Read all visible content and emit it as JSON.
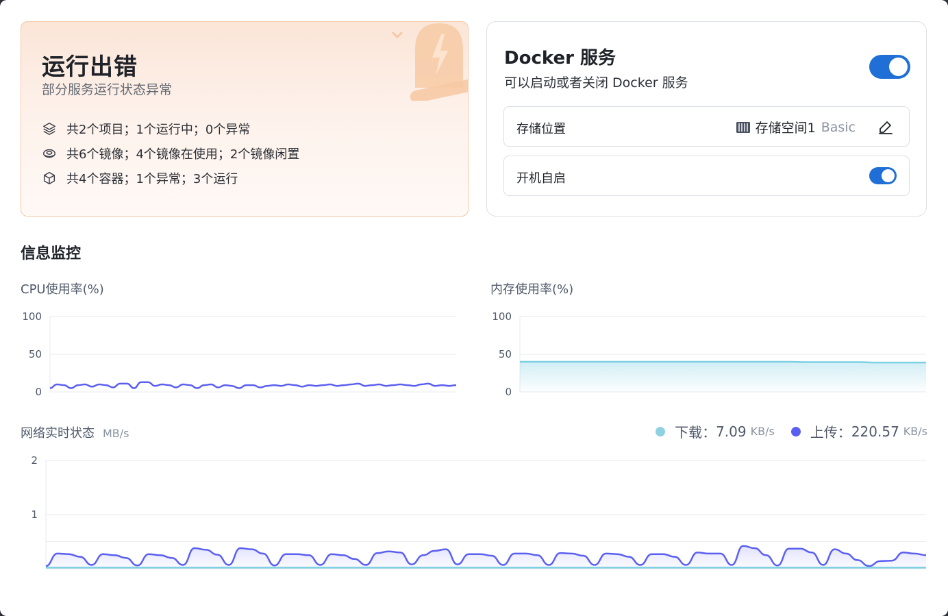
{
  "status": {
    "title": "运行出错",
    "subtitle": "部分服务运行状态异常",
    "items": [
      {
        "icon": "layers-icon",
        "text": "共2个项目；1个运行中；0个异常"
      },
      {
        "icon": "disk-image-icon",
        "text": "共6个镜像；4个镜像在使用；2个镜像闲置"
      },
      {
        "icon": "container-box-icon",
        "text": "共4个容器；1个异常；3个运行"
      }
    ]
  },
  "docker": {
    "title": "Docker 服务",
    "subtitle": "可以启动或者关闭 Docker 服务",
    "service_enabled": true,
    "storage_label": "存储位置",
    "storage_value": "存储空间1",
    "storage_type": "Basic",
    "autostart_label": "开机自启",
    "autostart_enabled": true
  },
  "monitor": {
    "section_title": "信息监控",
    "cpu_label": "CPU使用率(%)",
    "mem_label": "内存使用率(%)",
    "net_label": "网络实时状态",
    "net_unit": "MB/s",
    "download_label": "下载：",
    "download_value": "7.09",
    "download_unit": "KB/s",
    "upload_label": "上传：",
    "upload_value": "220.57",
    "upload_unit": "KB/s"
  },
  "colors": {
    "primary": "#1f6fd6",
    "upload_line": "#5b5ff0",
    "download_line": "#7dcfe2",
    "status_bg": "#fbe5d7",
    "alarm": "#f6c9a5"
  },
  "chart_data": [
    {
      "type": "line",
      "title": "CPU使用率(%)",
      "ylim": [
        0,
        100
      ],
      "yticks": [
        "100",
        "50",
        "0"
      ],
      "series": [
        {
          "values": [
            5,
            10,
            9,
            5,
            9,
            10,
            7,
            10,
            9,
            6,
            11,
            11,
            5,
            13,
            13,
            8,
            10,
            9,
            6,
            10,
            9,
            5,
            9,
            10,
            6,
            9,
            8,
            5,
            9,
            9,
            6,
            8,
            9,
            8,
            10,
            9,
            7,
            9,
            8,
            9,
            10,
            8,
            9,
            10,
            11,
            8,
            9,
            10,
            8,
            9,
            10,
            9,
            8,
            10,
            11,
            8,
            9,
            8,
            9
          ]
        }
      ]
    },
    {
      "type": "area",
      "title": "内存使用率(%)",
      "ylim": [
        0,
        100
      ],
      "yticks": [
        "100",
        "50",
        "0"
      ],
      "series": [
        {
          "values": [
            40,
            40,
            40,
            40,
            40,
            40,
            40,
            40,
            40,
            40,
            40,
            40,
            40,
            40,
            40,
            40,
            40,
            39.5,
            39.5,
            39.5,
            39.5,
            39,
            39,
            39,
            39
          ]
        }
      ]
    },
    {
      "type": "area",
      "title": "网络实时状态",
      "ylim": [
        0,
        2
      ],
      "yticks": [
        "2",
        "1"
      ],
      "series": [
        {
          "name": "上传",
          "values": [
            0.05,
            0.28,
            0.27,
            0.22,
            0.07,
            0.27,
            0.25,
            0.2,
            0.06,
            0.27,
            0.25,
            0.2,
            0.07,
            0.38,
            0.35,
            0.26,
            0.07,
            0.38,
            0.36,
            0.28,
            0.06,
            0.27,
            0.27,
            0.25,
            0.07,
            0.27,
            0.25,
            0.18,
            0.07,
            0.29,
            0.32,
            0.3,
            0.08,
            0.25,
            0.33,
            0.36,
            0.08,
            0.27,
            0.27,
            0.24,
            0.07,
            0.28,
            0.28,
            0.25,
            0.07,
            0.29,
            0.28,
            0.24,
            0.07,
            0.28,
            0.27,
            0.22,
            0.07,
            0.27,
            0.27,
            0.22,
            0.07,
            0.3,
            0.28,
            0.28,
            0.07,
            0.42,
            0.38,
            0.25,
            0.06,
            0.37,
            0.37,
            0.3,
            0.07,
            0.36,
            0.28,
            0.16,
            0.05,
            0.14,
            0.15,
            0.3,
            0.28,
            0.25
          ]
        },
        {
          "name": "下载",
          "values": [
            0.02,
            0.02,
            0.02,
            0.02,
            0.02,
            0.02,
            0.02,
            0.02,
            0.02,
            0.02,
            0.02,
            0.02,
            0.02,
            0.02,
            0.02,
            0.02,
            0.02,
            0.02,
            0.02,
            0.02,
            0.02,
            0.02,
            0.02,
            0.02,
            0.02,
            0.02,
            0.02,
            0.02,
            0.02,
            0.02
          ]
        }
      ]
    }
  ]
}
